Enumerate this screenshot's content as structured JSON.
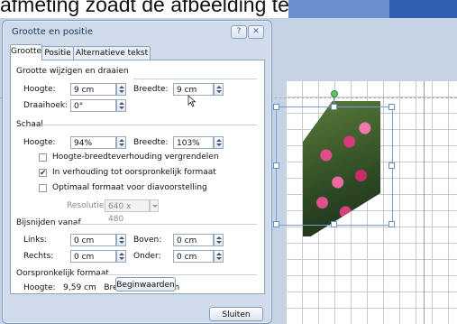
{
  "document": {
    "top_text": "afmeting zoadt de afbeelding terug een vie"
  },
  "dialog": {
    "title": "Grootte en positie",
    "help_button": "?",
    "close_button": "✕",
    "tabs": [
      {
        "label": "Grootte",
        "active": true
      },
      {
        "label": "Positie",
        "active": false
      },
      {
        "label": "Alternatieve tekst",
        "active": false
      }
    ],
    "resize_rotate": {
      "heading": "Grootte wijzigen en draaien",
      "height_label": "Hoogte:",
      "height_value": "9 cm",
      "width_label": "Breedte:",
      "width_value": "9 cm",
      "rotation_label": "Draaihoek:",
      "rotation_value": "0°"
    },
    "scale": {
      "heading": "Schaal",
      "height_label": "Hoogte:",
      "height_value": "94%",
      "width_label": "Breedte:",
      "width_value": "103%",
      "lock_aspect_label": "Hoogte-breedteverhouding vergrendelen",
      "lock_aspect_checked": false,
      "relative_label": "In verhouding tot oorspronkelijk formaat",
      "relative_checked": true,
      "best_scale_label": "Optimaal formaat voor diavoorstelling",
      "best_scale_checked": false,
      "resolution_label": "Resolutie",
      "resolution_value": "640 x 480"
    },
    "crop": {
      "heading": "Bijsnijden vanaf",
      "left_label": "Links:",
      "left_value": "0 cm",
      "top_label": "Boven:",
      "top_value": "0 cm",
      "right_label": "Rechts:",
      "right_value": "0 cm",
      "bottom_label": "Onder:",
      "bottom_value": "0 cm"
    },
    "original": {
      "heading": "Oorspronkelijk formaat",
      "summary": "Hoogte:   9,59 cm   Breedte:   8,71 cm",
      "reset_button": "Beginwaarden"
    },
    "close_label": "Sluiten"
  },
  "colors": {
    "dialog_bg": "#cfdbea",
    "ribbon_blue": "#2f5fae",
    "checkbox_mark": "#1d3a6a"
  }
}
